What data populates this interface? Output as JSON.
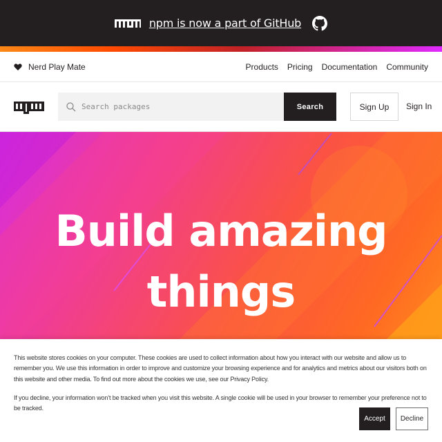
{
  "banner": {
    "logo_text": "npm",
    "link_text": "npm is now a part of GitHub",
    "icon": "github-icon"
  },
  "colors": {
    "dark": "#231f20",
    "gradient": [
      "#fb8817",
      "#ff4b01",
      "#c12127",
      "#e02aff"
    ],
    "hero": [
      "#d62ce3",
      "#f13e8f",
      "#fb5244",
      "#ff6a22"
    ]
  },
  "subnav": {
    "icon": "heart-icon",
    "tagline": "Nerd Play Mate",
    "links": [
      "Products",
      "Pricing",
      "Documentation",
      "Community"
    ]
  },
  "search": {
    "logo_text": "npm",
    "placeholder": "Search packages",
    "icon": "search-icon",
    "button": "Search",
    "signup": "Sign Up",
    "signin": "Sign In"
  },
  "hero": {
    "line1": "Build amazing",
    "line2": "things"
  },
  "cookie": {
    "text1": "This website stores cookies on your computer. These cookies are used to collect information about how you interact with our website and allow us to remember you. We use this information in order to improve and customize your browsing experience and for analytics and metrics about our visitors both on this website and other media. To find out more about the cookies we use, see our Privacy Policy.",
    "text2": "If you decline, your information won’t be tracked when you visit this website. A single cookie will be used in your browser to remember your preference not to be tracked.",
    "accept": "Accept",
    "decline": "Decline"
  }
}
